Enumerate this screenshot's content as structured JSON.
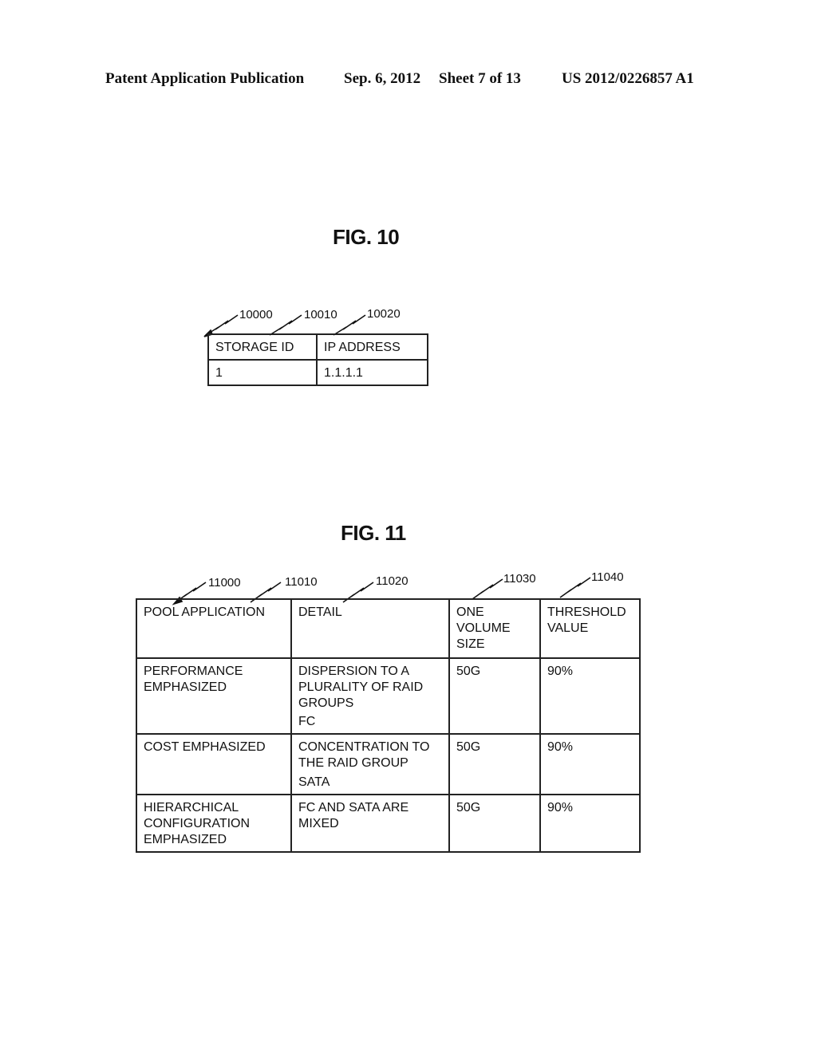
{
  "header": {
    "publication": "Patent Application Publication",
    "date": "Sep. 6, 2012",
    "sheet": "Sheet 7 of 13",
    "number": "US 2012/0226857 A1"
  },
  "fig10": {
    "title": "FIG. 10",
    "refs": [
      "10000",
      "10010",
      "10020"
    ],
    "columns": [
      "STORAGE ID",
      "IP ADDRESS"
    ],
    "rows": [
      [
        "1",
        "1.1.1.1"
      ]
    ]
  },
  "fig11": {
    "title": "FIG. 11",
    "refs": [
      "11000",
      "11010",
      "11020",
      "11030",
      "11040"
    ],
    "columns": [
      [
        "POOL APPLICATION"
      ],
      [
        "DETAIL"
      ],
      [
        "ONE",
        "VOLUME",
        "SIZE"
      ],
      [
        "THRESHOLD",
        "VALUE"
      ]
    ],
    "rows": [
      {
        "pool_application": [
          "PERFORMANCE",
          "EMPHASIZED"
        ],
        "detail": [
          "DISPERSION TO A",
          "PLURALITY OF RAID",
          "GROUPS",
          "FC"
        ],
        "volume_size": "50G",
        "threshold": "90%"
      },
      {
        "pool_application": [
          "COST EMPHASIZED"
        ],
        "detail": [
          "CONCENTRATION TO",
          "THE RAID GROUP",
          "SATA"
        ],
        "volume_size": "50G",
        "threshold": "90%"
      },
      {
        "pool_application": [
          "HIERARCHICAL",
          "CONFIGURATION",
          "EMPHASIZED"
        ],
        "detail": [
          "FC AND SATA ARE",
          "MIXED"
        ],
        "volume_size": "50G",
        "threshold": "90%"
      }
    ]
  }
}
